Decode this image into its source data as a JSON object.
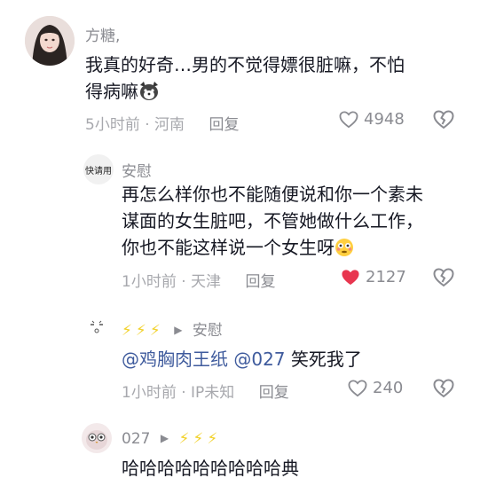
{
  "comments": [
    {
      "username": "方糖,",
      "lines": [
        "我真的好奇…男的不觉得嫖很脏嘛，不怕",
        "得病嘛"
      ],
      "emoji": "dog-emoji",
      "time": "5小时前",
      "location": "河南",
      "reply_label": "回复",
      "likes": "4948",
      "liked": false
    },
    {
      "username": "安慰",
      "avatar_text": "快请用",
      "lines": [
        "再怎么样你也不能随便说和你一个素未",
        "谋面的女生脏吧，不管她做什么工作，",
        "你也不能这样说一个女生呀"
      ],
      "emoji": "flushed-face-emoji",
      "time": "1小时前",
      "location": "天津",
      "reply_label": "回复",
      "likes": "2127",
      "liked": true
    },
    {
      "username_icons": "lightning-icons",
      "reply_to": "安慰",
      "mention_1": "@鸡胸肉王纸",
      "mention_2": "@027",
      "text": "笑死我了",
      "time": "1小时前",
      "location": "IP未知",
      "reply_label": "回复",
      "likes": "240",
      "liked": false
    },
    {
      "username": "027",
      "reply_to_icons": "lightning-icons",
      "text": "哈哈哈哈哈哈哈哈哈典"
    }
  ],
  "colors": {
    "liked_heart": "#e8364f",
    "lightning": "#f2d22e",
    "mention": "#3f5b9d"
  }
}
